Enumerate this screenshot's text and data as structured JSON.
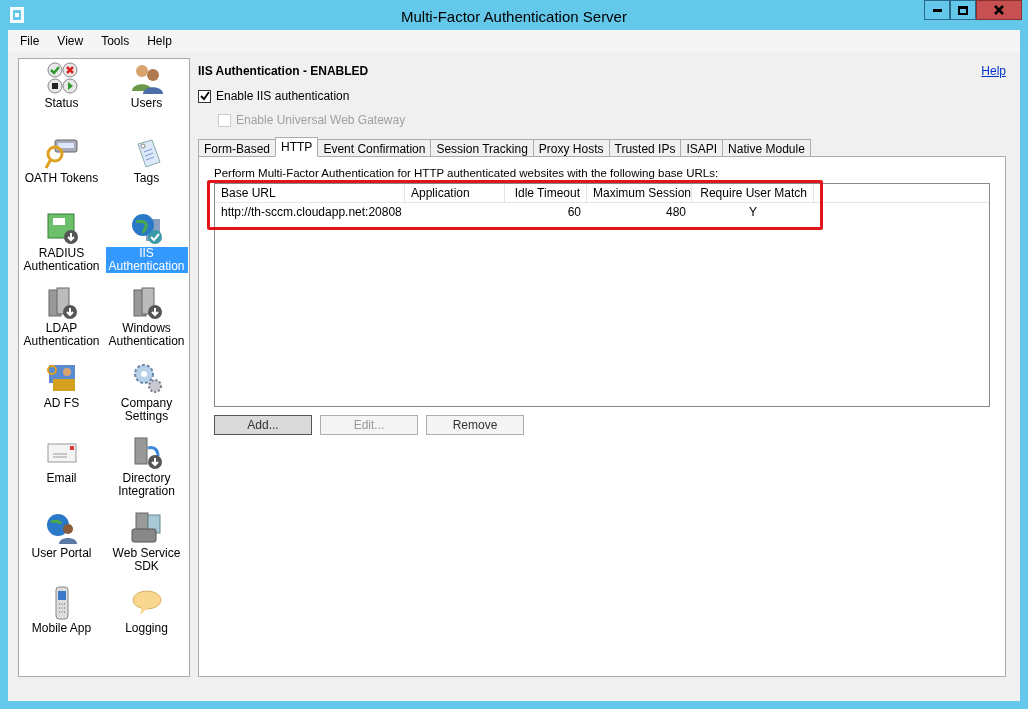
{
  "window": {
    "title": "Multi-Factor Authentication Server"
  },
  "menu": [
    "File",
    "View",
    "Tools",
    "Help"
  ],
  "sidebar": {
    "items": [
      {
        "label": "Status",
        "selected": false
      },
      {
        "label": "Users",
        "selected": false
      },
      {
        "label": "OATH Tokens",
        "selected": false
      },
      {
        "label": "Tags",
        "selected": false
      },
      {
        "label": "RADIUS Authentication",
        "selected": false
      },
      {
        "label": "IIS Authentication",
        "selected": true
      },
      {
        "label": "LDAP Authentication",
        "selected": false
      },
      {
        "label": "Windows Authentication",
        "selected": false
      },
      {
        "label": "AD FS",
        "selected": false
      },
      {
        "label": "Company Settings",
        "selected": false
      },
      {
        "label": "Email",
        "selected": false
      },
      {
        "label": "Directory Integration",
        "selected": false
      },
      {
        "label": "User Portal",
        "selected": false
      },
      {
        "label": "Web Service SDK",
        "selected": false
      },
      {
        "label": "Mobile App",
        "selected": false
      },
      {
        "label": "Logging",
        "selected": false
      }
    ]
  },
  "heading": "IIS Authentication - ENABLED",
  "help_link": "Help",
  "checkboxes": [
    {
      "label": "Enable IIS authentication",
      "checked": true,
      "disabled": false
    },
    {
      "label": "Enable Universal Web Gateway",
      "checked": false,
      "disabled": true
    }
  ],
  "tabs": [
    {
      "label": "Form-Based",
      "selected": false
    },
    {
      "label": "HTTP",
      "selected": true
    },
    {
      "label": "Event Confirmation",
      "selected": false
    },
    {
      "label": "Session Tracking",
      "selected": false
    },
    {
      "label": "Proxy Hosts",
      "selected": false
    },
    {
      "label": "Trusted IPs",
      "selected": false
    },
    {
      "label": "ISAPI",
      "selected": false
    },
    {
      "label": "Native Module",
      "selected": false
    }
  ],
  "description": "Perform Multi-Factor Authentication for HTTP authenticated websites with the following base URLs:",
  "table": {
    "columns": [
      "Base URL",
      "Application",
      "Idle Timeout",
      "Maximum Session",
      "Require User Match"
    ],
    "rows": [
      [
        "http://th-sccm.cloudapp.net:20808",
        "",
        "60",
        "480",
        "Y"
      ]
    ]
  },
  "buttons": [
    {
      "label": "Add...",
      "disabled": false,
      "default": true
    },
    {
      "label": "Edit...",
      "disabled": true,
      "default": false
    },
    {
      "label": "Remove",
      "disabled": false,
      "default": false
    }
  ]
}
